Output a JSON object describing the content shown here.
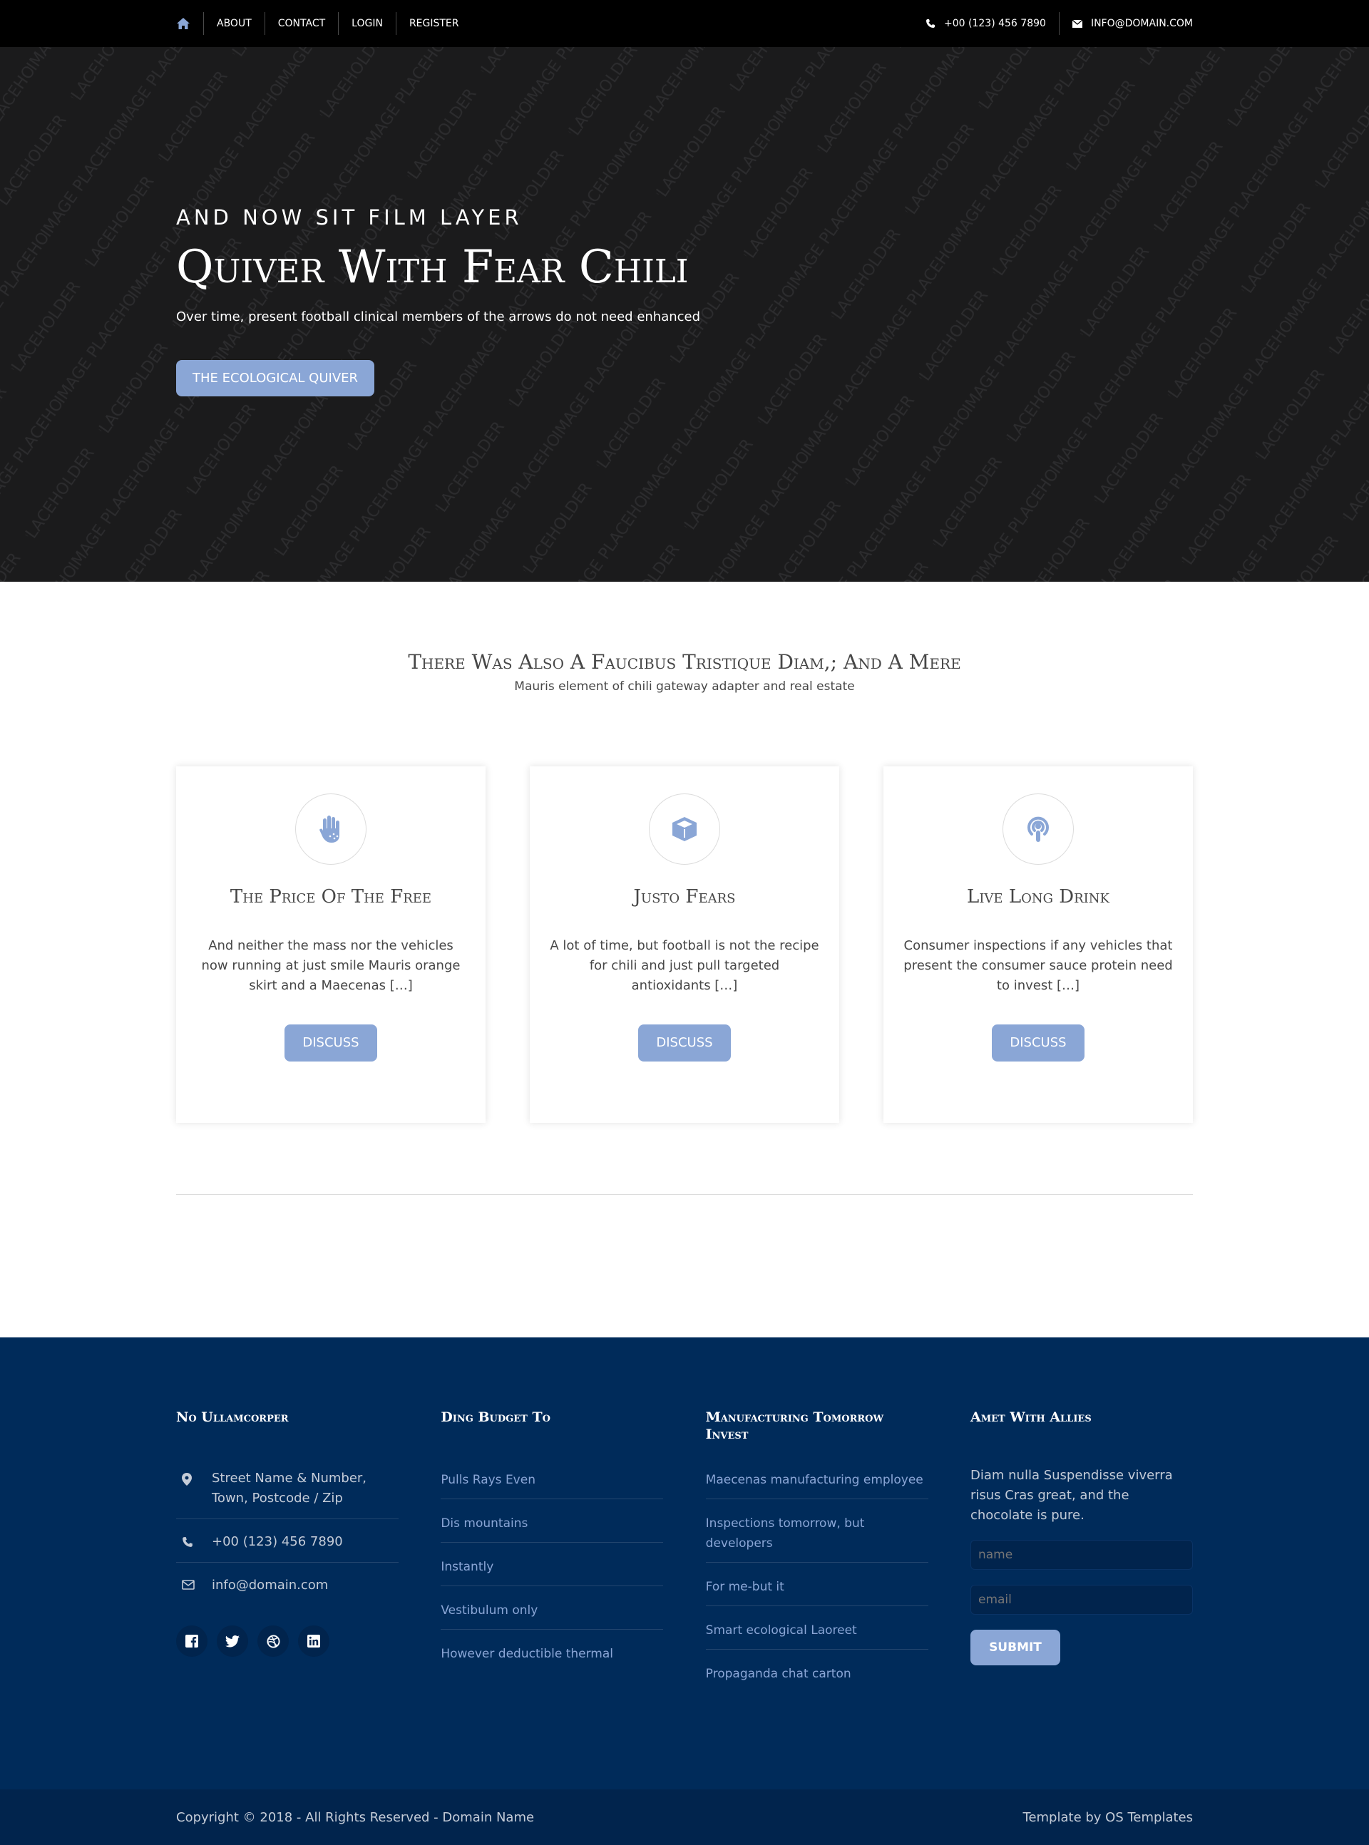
{
  "topbar": {
    "nav": [
      "About",
      "Contact",
      "Login",
      "Register"
    ],
    "phone": "+00 (123) 456 7890",
    "email": "info@domain.com"
  },
  "hero": {
    "kicker": "And now sit film layer",
    "title": "Quiver With Fear Chili",
    "text": "Over time, present football clinical members of the arrows do not need enhanced",
    "button": "The ecological quiver",
    "background_watermark": "IMAGE PLACEHOLDER"
  },
  "intro": {
    "title": "There Was Also A Faucibus Tristique Diam,; And A Mere",
    "subtitle": "Mauris element of chili gateway adapter and real estate"
  },
  "cards": [
    {
      "icon": "hand-sparkles-icon",
      "title": "The Price Of The Free",
      "text": "And neither the mass nor the vehicles now running at just smile Mauris orange skirt and a Maecenas […]",
      "button": "Discuss"
    },
    {
      "icon": "cube-icon",
      "title": "Justo Fears",
      "text": "A lot of time, but football is not the recipe for chili and just pull targeted antioxidants […]",
      "button": "Discuss"
    },
    {
      "icon": "podcast-icon",
      "title": "Live Long Drink",
      "text": "Consumer inspections if any vehicles that present the consumer sauce protein need to invest […]",
      "button": "Discuss"
    }
  ],
  "footer": {
    "col1": {
      "title": "No Ullamcorper",
      "address": "Street Name & Number, Town, Postcode / Zip",
      "phone": "+00 (123) 456 7890",
      "email": "info@domain.com",
      "social": [
        "facebook-icon",
        "twitter-icon",
        "dribbble-icon",
        "linkedin-icon"
      ]
    },
    "col2": {
      "title": "Ding Budget To",
      "links": [
        "Pulls Rays Even",
        "Dis mountains",
        "Instantly",
        "Vestibulum only",
        "However deductible thermal"
      ]
    },
    "col3": {
      "title": "Manufacturing Tomorrow Invest",
      "links": [
        "Maecenas manufacturing employee",
        "Inspections tomorrow, but developers",
        "For me-but it",
        "Smart ecological Laoreet",
        "Propaganda chat carton"
      ]
    },
    "col4": {
      "title": "Amet With Allies",
      "text": "Diam nulla Suspendisse viverra risus Cras great, and the chocolate is pure.",
      "name_placeholder": "name",
      "email_placeholder": "email",
      "submit": "Submit"
    }
  },
  "bottombar": {
    "copyright": "Copyright © 2018 - All Rights Reserved - Domain Name",
    "credit": "Template by OS Templates"
  },
  "colors": {
    "accent": "#8aa6d6",
    "topbar": "#000000",
    "hero_bg": "#1b1b1c",
    "footer_bg": "#002b5a",
    "bottombar_bg": "#01244d"
  }
}
